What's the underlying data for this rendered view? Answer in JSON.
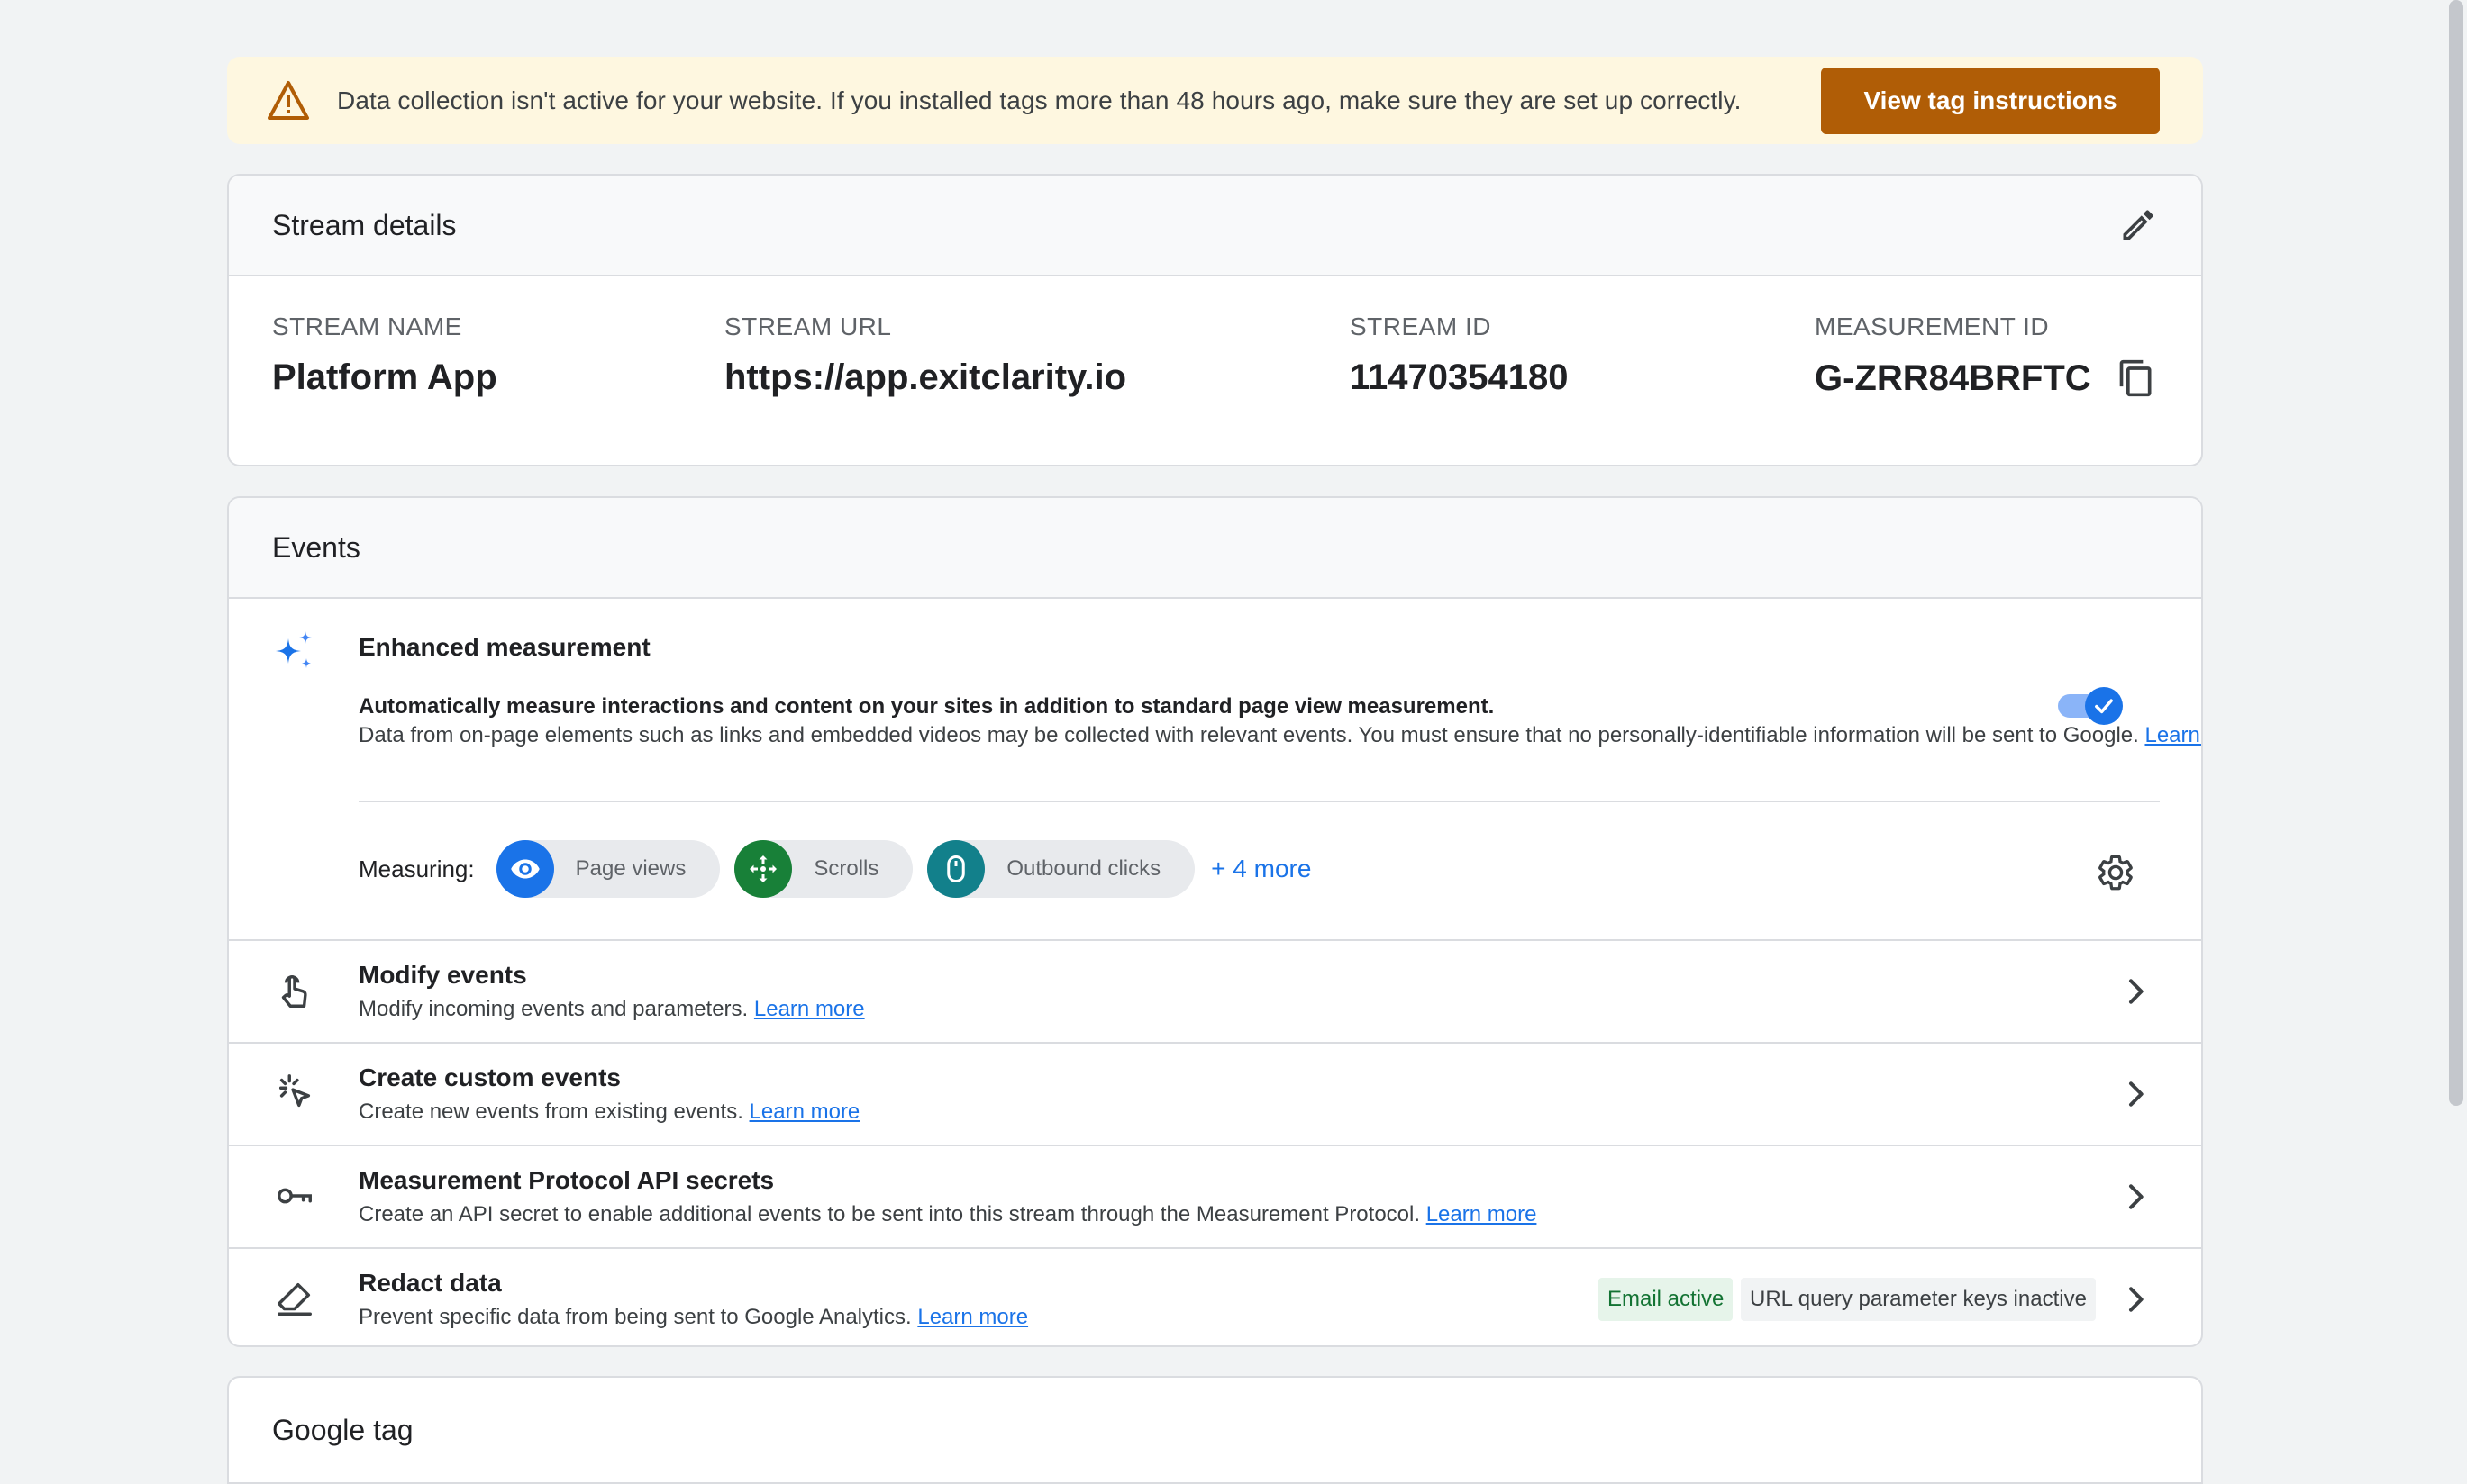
{
  "banner": {
    "text": "Data collection isn't active for your website. If you installed tags more than 48 hours ago, make sure they are set up correctly.",
    "button_label": "View tag instructions",
    "icon": "warning-triangle-icon",
    "colors": {
      "background": "#fef7e0",
      "button": "#b05d06"
    }
  },
  "stream_details": {
    "title": "Stream details",
    "edit_icon": "pencil-icon",
    "fields": [
      {
        "label": "STREAM NAME",
        "value": "Platform App"
      },
      {
        "label": "STREAM URL",
        "value": "https://app.exitclarity.io"
      },
      {
        "label": "STREAM ID",
        "value": "11470354180"
      },
      {
        "label": "MEASUREMENT ID",
        "value": "G-ZRR84BRFTC"
      }
    ],
    "copy_icon": "copy-icon"
  },
  "events": {
    "title": "Events",
    "enhanced": {
      "title": "Enhanced measurement",
      "desc_bold": "Automatically measure interactions and content on your sites in addition to standard page view measurement.",
      "desc": "Data from on-page elements such as links and embedded videos may be collected with relevant events. You must ensure that no personally-identifiable information will be sent to Google.",
      "learn_more": "Learn more",
      "toggle_on": true,
      "measuring_label": "Measuring:",
      "chips": [
        {
          "label": "Page views",
          "icon": "eye-icon",
          "color": "#1a73e8"
        },
        {
          "label": "Scrolls",
          "icon": "scroll-arrows-icon",
          "color": "#188038"
        },
        {
          "label": "Outbound clicks",
          "icon": "mouse-icon",
          "color": "#12808b"
        }
      ],
      "more_label": "+ 4 more"
    },
    "rows": [
      {
        "title": "Modify events",
        "subtitle": "Modify incoming events and parameters.",
        "link": "Learn more",
        "icon": "touch-hand-icon"
      },
      {
        "title": "Create custom events",
        "subtitle": "Create new events from existing events.",
        "link": "Learn more",
        "icon": "click-sparkle-icon"
      },
      {
        "title": "Measurement Protocol API secrets",
        "subtitle": "Create an API secret to enable additional events to be sent into this stream through the Measurement Protocol.",
        "link": "Learn more",
        "icon": "key-icon"
      },
      {
        "title": "Redact data",
        "subtitle": "Prevent specific data from being sent to Google Analytics.",
        "link": "Learn more",
        "icon": "eraser-icon",
        "badges": [
          "Email active",
          "URL query parameter keys inactive"
        ]
      }
    ]
  },
  "google_tag": {
    "title": "Google tag"
  }
}
